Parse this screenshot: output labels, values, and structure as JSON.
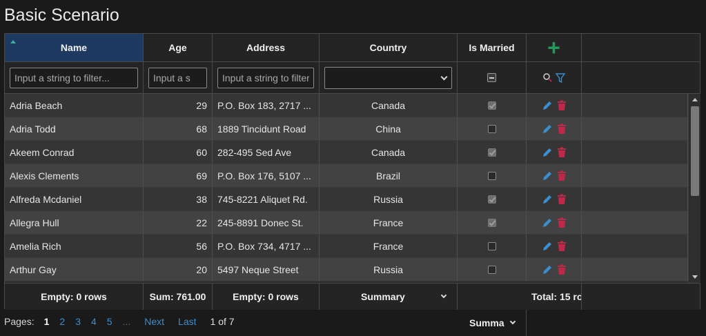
{
  "page": {
    "title": "Basic Scenario"
  },
  "grid": {
    "columns": {
      "name": "Name",
      "age": "Age",
      "address": "Address",
      "country": "Country",
      "married": "Is Married"
    },
    "filters": {
      "name_placeholder": "Input a string to filter...",
      "age_placeholder": "Input a s",
      "address_placeholder": "Input a string to filter...",
      "country_value": ""
    },
    "rows": [
      {
        "name": "Adria Beach",
        "age": "29",
        "address": "P.O. Box 183, 2717 ...",
        "country": "Canada",
        "married": true
      },
      {
        "name": "Adria Todd",
        "age": "68",
        "address": "1889 Tincidunt Road",
        "country": "China",
        "married": false
      },
      {
        "name": "Akeem Conrad",
        "age": "60",
        "address": "282-495 Sed Ave",
        "country": "Canada",
        "married": true
      },
      {
        "name": "Alexis Clements",
        "age": "69",
        "address": "P.O. Box 176, 5107 ...",
        "country": "Brazil",
        "married": false
      },
      {
        "name": "Alfreda Mcdaniel",
        "age": "38",
        "address": "745-8221 Aliquet Rd.",
        "country": "Russia",
        "married": true
      },
      {
        "name": "Allegra Hull",
        "age": "22",
        "address": "245-8891 Donec St.",
        "country": "France",
        "married": true
      },
      {
        "name": "Amelia Rich",
        "age": "56",
        "address": "P.O. Box 734, 4717 ...",
        "country": "France",
        "married": false
      },
      {
        "name": "Arthur Gay",
        "age": "20",
        "address": "5497 Neque Street",
        "country": "Russia",
        "married": false
      }
    ],
    "footer": {
      "name": "Empty: 0 rows",
      "age": "Sum: 761.00",
      "address": "Empty: 0 rows",
      "country": "Summary",
      "married": "Summa",
      "total": "Total: 15 ro"
    },
    "colors": {
      "accent_header": "#1e3a60",
      "add": "#1f9a5a",
      "edit": "#3a8fd0",
      "delete": "#c0284a"
    }
  },
  "pager": {
    "label": "Pages:",
    "pages": [
      "1",
      "2",
      "3",
      "4",
      "5"
    ],
    "current": "1",
    "ellipsis": "...",
    "next": "Next",
    "last": "Last",
    "info": "1 of 7"
  }
}
